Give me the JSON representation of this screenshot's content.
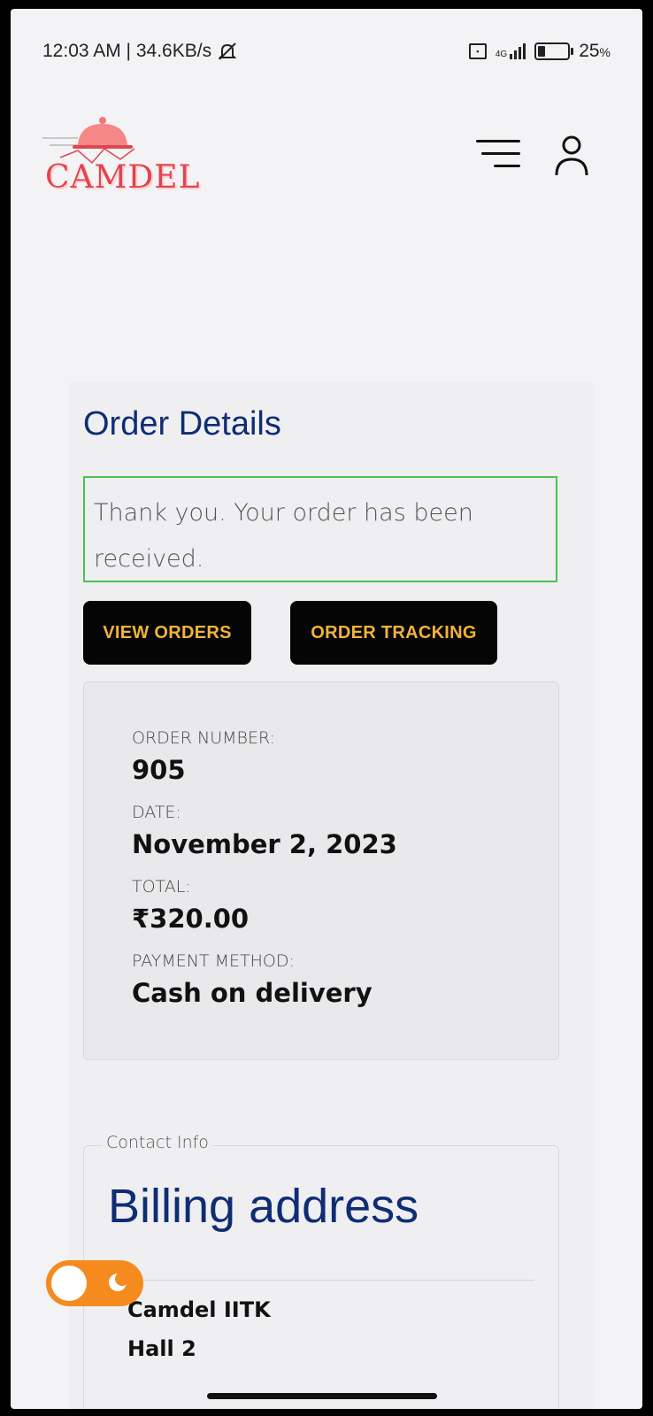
{
  "status_bar": {
    "time_speed": "12:03 AM | 34.6KB/s",
    "network_type": "4G",
    "battery_percent": "25",
    "battery_unit": "%",
    "battery_level": 0.25
  },
  "header": {
    "logo_text": "CAMDEL",
    "menu_icon": "hamburger-menu-icon",
    "account_icon": "user-icon"
  },
  "order": {
    "title": "Order Details",
    "notice": "Thank you. Your order has been received.",
    "buttons": {
      "view_orders": "VIEW ORDERS",
      "order_tracking": "ORDER TRACKING"
    },
    "summary": {
      "order_number_label": "ORDER NUMBER:",
      "order_number": "905",
      "date_label": "DATE:",
      "date": "November 2, 2023",
      "total_label": "TOTAL:",
      "total": "₹320.00",
      "payment_label": "PAYMENT METHOD:",
      "payment": "Cash on delivery"
    }
  },
  "contact": {
    "legend": "Contact Info",
    "billing_title": "Billing address",
    "lines": [
      "Camdel IITK",
      "Hall 2"
    ]
  },
  "theme_toggle": {
    "icon": "moon-icon",
    "accent": "#f58a1f"
  },
  "colors": {
    "brand_blue": "#0f2d74",
    "button_bg": "#050505",
    "button_text": "#f2b33a",
    "success_border": "#4ac24f",
    "logo_red": "#e04550"
  }
}
